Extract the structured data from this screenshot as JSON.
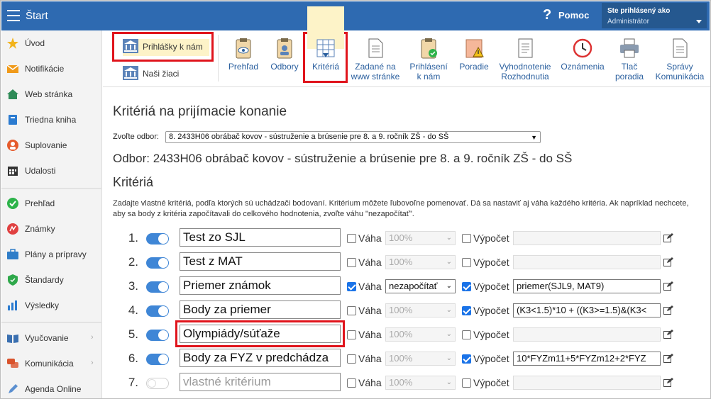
{
  "app": {
    "title": "Štart",
    "help": "?",
    "help_label": "Pomoc",
    "user_line1": "Ste prihlásený ako",
    "user_line2": "Administrátor"
  },
  "sidebar": {
    "items": [
      {
        "label": "Úvod",
        "icon": "star-icon",
        "color": "#f2b31b"
      },
      {
        "label": "Notifikácie",
        "icon": "envelope-icon",
        "color": "#f09a1a"
      },
      {
        "label": "Web stránka",
        "icon": "home-icon",
        "color": "#2e8b57"
      },
      {
        "label": "Triedna kniha",
        "icon": "book-icon",
        "color": "#2b7bd0"
      },
      {
        "label": "Suplovanie",
        "icon": "person-icon",
        "color": "#e55b2c"
      },
      {
        "label": "Udalosti",
        "icon": "calendar-icon",
        "color": "#333333"
      },
      {
        "label": "Prehľad",
        "icon": "check-circle-icon",
        "color": "#2db34a"
      },
      {
        "label": "Známky",
        "icon": "grade-icon",
        "color": "#e04040"
      },
      {
        "label": "Plány a prípravy",
        "icon": "briefcase-icon",
        "color": "#2f7dc8"
      },
      {
        "label": "Štandardy",
        "icon": "shield-icon",
        "color": "#2ea84a"
      },
      {
        "label": "Výsledky",
        "icon": "bar-chart-icon",
        "color": "#2b7bd0"
      },
      {
        "label": "Vyučovanie",
        "icon": "book-open-icon",
        "color": "#3a6fb0",
        "arrow": "›"
      },
      {
        "label": "Komunikácia",
        "icon": "chat-icon",
        "color": "#d9532c",
        "arrow": "›"
      },
      {
        "label": "Agenda Online",
        "icon": "pen-icon",
        "color": "#5b8fd0"
      }
    ]
  },
  "toolbar": {
    "prihlasky": "Prihlášky k nám",
    "nasi_ziaci": "Naši žiaci",
    "buttons": [
      {
        "label": "Prehľad",
        "icon": "clipboard-eye-icon"
      },
      {
        "label": "Odbory",
        "icon": "clipboard-user-icon"
      },
      {
        "label": "Kritériá",
        "icon": "table-sort-icon"
      },
      {
        "label": "Zadané na\nwww stránke",
        "icon": "document-icon"
      },
      {
        "label": "Prihlásení\nk nám",
        "icon": "clipboard-check-icon"
      },
      {
        "label": "Poradie",
        "icon": "warning-doc-icon"
      },
      {
        "label": "Vyhodnotenie\nRozhodnutia",
        "icon": "document-list-icon"
      },
      {
        "label": "Oznámenia",
        "icon": "clock-icon"
      },
      {
        "label": "Tlač\nporadia",
        "icon": "printer-icon"
      },
      {
        "label": "Správy\nKomunikácia",
        "icon": "message-doc-icon"
      }
    ]
  },
  "main": {
    "title": "Kritériá na prijímacie konanie",
    "select_label": "Zvoľte odbor:",
    "select_value": "8. 2433H06 obrábač kovov - sústruženie a brúsenie pre 8. a 9. ročník ZŠ - do SŠ",
    "odbor_heading": "Odbor: 2433H06 obrábač kovov - sústruženie a brúsenie pre 8. a 9. ročník ZŠ - do SŠ",
    "criteria_heading": "Kritériá",
    "description": "Zadajte vlastné kritériá, podľa ktorých sú uchádzači bodovaní. Kritérium môžete ľubovoľne pomenovať. Dá sa nastaviť aj váha každého kritéria. Ak napríklad nechcete, aby sa body z kritéria započítavali do celkového hodnotenia, zvoľte váhu \"nezapočítať\".",
    "weight_label": "Váha",
    "calc_label": "Výpočet",
    "rows": [
      {
        "num": "1.",
        "on": true,
        "name": "Test zo SJL",
        "weight_checked": false,
        "weight": "100%",
        "calc_checked": false,
        "calc": ""
      },
      {
        "num": "2.",
        "on": true,
        "name": "Test z MAT",
        "weight_checked": false,
        "weight": "100%",
        "calc_checked": false,
        "calc": ""
      },
      {
        "num": "3.",
        "on": true,
        "name": "Priemer známok",
        "weight_checked": true,
        "weight": "nezapočítať",
        "calc_checked": true,
        "calc": "priemer(SJL9, MAT9)"
      },
      {
        "num": "4.",
        "on": true,
        "name": "Body za priemer",
        "weight_checked": false,
        "weight": "100%",
        "calc_checked": true,
        "calc": "(K3<1.5)*10 + ((K3>=1.5)&(K3<"
      },
      {
        "num": "5.",
        "on": true,
        "name": "Olympiády/súťaže",
        "weight_checked": false,
        "weight": "100%",
        "calc_checked": false,
        "calc": ""
      },
      {
        "num": "6.",
        "on": true,
        "name": "Body za FYZ v predchádza",
        "weight_checked": false,
        "weight": "100%",
        "calc_checked": true,
        "calc": "10*FYZm11+5*FYZm12+2*FYZ"
      },
      {
        "num": "7.",
        "on": false,
        "name": "",
        "placeholder": "vlastné kritérium",
        "weight_checked": false,
        "weight": "100%",
        "calc_checked": false,
        "calc": ""
      }
    ]
  }
}
